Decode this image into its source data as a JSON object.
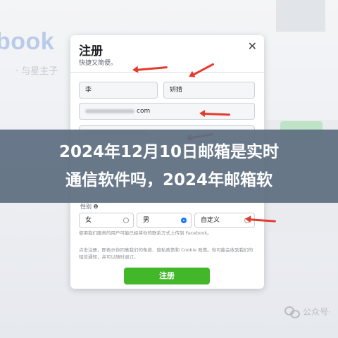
{
  "background": {
    "brand_text": "book",
    "brand_sub": "· 与星主子"
  },
  "dialog": {
    "title": "注册",
    "subtitle": "快捷又简便。",
    "close_glyph": "✕",
    "first_name_value": "李",
    "last_name_value": "妍婧",
    "email_suffix": "com",
    "gender_label": "性别 ❶",
    "gender_options": [
      "女",
      "男",
      "自定义"
    ],
    "selected_gender": "自定义",
    "terms_text_1": "使用我们服务的用户可能已经将你的联系方式上传到 Facebook。",
    "terms_text_2": "点击注册，即表示你同意我们的条款、隐私政策和 Cookie 政策。你可能会收到我们的短信通知，并可以随时退订。",
    "submit_label": "注册"
  },
  "banner": {
    "line1": "2024年12月10日邮箱是实时",
    "line2": "通信软件吗，2024年邮箱软"
  },
  "watermark": {
    "text": "公众号·"
  },
  "colors": {
    "accent_green": "#42b72a",
    "arrow_red": "#e33b2e",
    "banner_bg": "#5e6e80",
    "radio_blue": "#1877f2"
  }
}
